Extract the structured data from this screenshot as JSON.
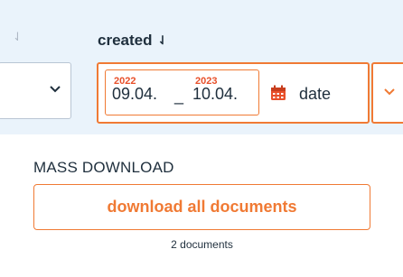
{
  "table_header": {
    "prev_column_sort_icon": "sort-down-arrow",
    "created_column": {
      "title": "created",
      "sort_icon": "sort-down-arrow"
    }
  },
  "filters": {
    "left_select": {
      "icon": "chevron-down"
    },
    "date_range": {
      "from_year": "2022",
      "from_day": "09.04.",
      "separator": "_",
      "to_year": "2023",
      "to_day": "10.04.",
      "icon": "calendar",
      "mode_label": "date"
    },
    "right_select": {
      "icon": "chevron-down"
    }
  },
  "mass_download": {
    "title": "MASS DOWNLOAD",
    "button_label": "download all documents",
    "count_text": "2 documents"
  },
  "colors": {
    "accent": "#f07a34",
    "year_text": "#e8502a",
    "header_bg": "#eaf3fb",
    "text": "#1f2f3d"
  }
}
